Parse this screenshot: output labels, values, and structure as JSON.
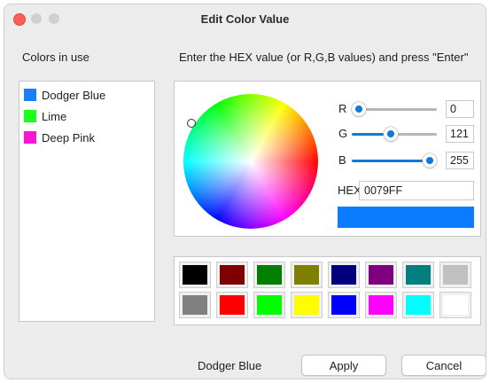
{
  "window": {
    "title": "Edit Color Value",
    "traffic_lights": [
      "close-button",
      "minimize-button",
      "zoom-button"
    ]
  },
  "left_panel": {
    "heading": "Colors in use",
    "items": [
      {
        "label": "Dodger Blue",
        "color": "#1a7ff6"
      },
      {
        "label": "Lime",
        "color": "#1cfe1c"
      },
      {
        "label": "Deep Pink",
        "color": "#fb14d4"
      }
    ]
  },
  "right_panel": {
    "heading": "Enter the HEX value (or R,G,B values) and press \"Enter\""
  },
  "picker": {
    "r_label": "R",
    "g_label": "G",
    "b_label": "B",
    "r_value": "0",
    "g_value": "121",
    "b_value": "255",
    "hex_label": "HEX",
    "hex_value": "0079FF",
    "preview_color": "#0b7cff",
    "accent_color": "#0a7bdb"
  },
  "palette": {
    "row1": [
      "#000000",
      "#7f0000",
      "#007f00",
      "#7f7f00",
      "#00007f",
      "#7f007f",
      "#007f7f",
      "#c0c0c0"
    ],
    "row2": [
      "#808080",
      "#fe0000",
      "#00fe00",
      "#fefe00",
      "#0000fe",
      "#fe00fe",
      "#00fefe",
      "#ffffff"
    ]
  },
  "footer": {
    "selected_name": "Dodger Blue",
    "apply_label": "Apply",
    "cancel_label": "Cancel"
  }
}
